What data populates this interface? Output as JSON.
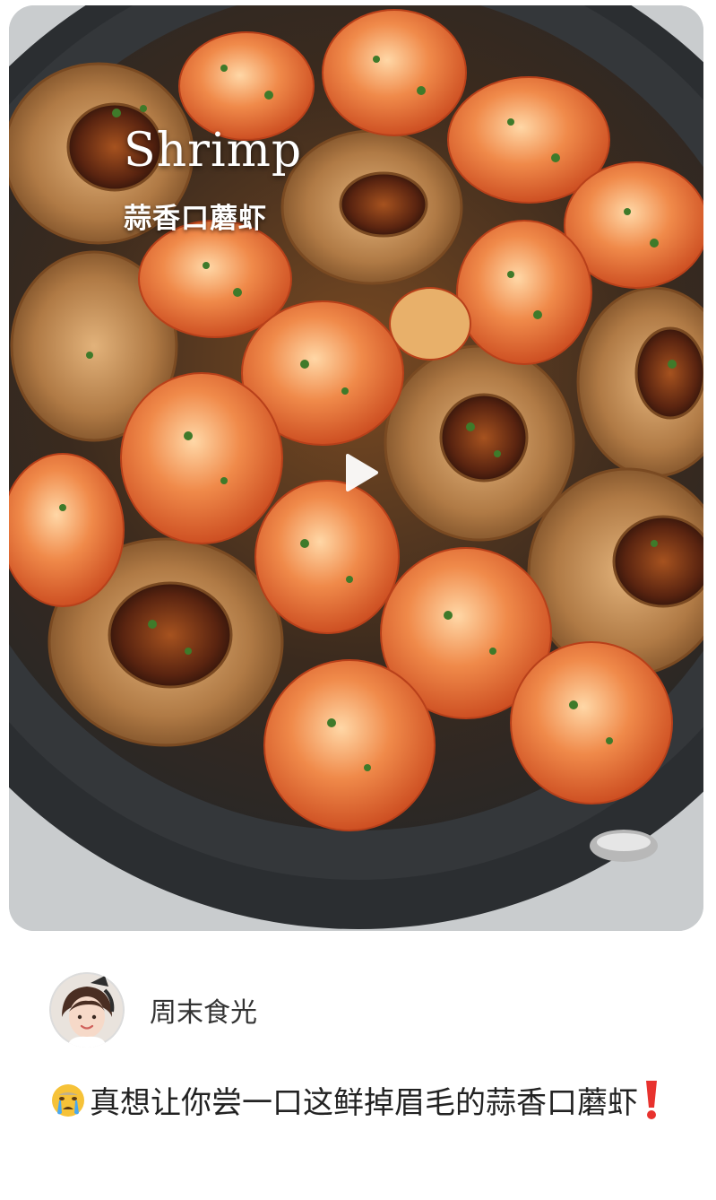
{
  "post": {
    "overlay_title": "Shrimp",
    "overlay_subtitle": "蒜香口蘑虾",
    "media_type": "video",
    "play_icon": "play-icon"
  },
  "author": {
    "name": "周末食光",
    "avatar_icon": "avatar"
  },
  "caption": {
    "leading_emoji": "crying-face-emoji",
    "text": "真想让你尝一口这鲜掉眉毛的蒜香口蘑虾",
    "trailing_emoji": "red-exclamation-emoji"
  },
  "colors": {
    "pan": "#2e3134",
    "shrimp": "#e8692e",
    "mushroom": "#b07a45",
    "garnish": "#3f7a2a",
    "text": "#222222"
  }
}
